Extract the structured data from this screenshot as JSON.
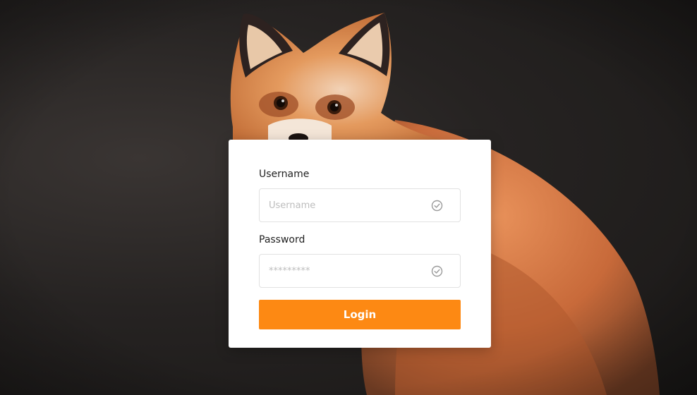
{
  "background": {
    "image": "red-fox-photo"
  },
  "form": {
    "username": {
      "label": "Username",
      "placeholder": "Username",
      "value": "",
      "icon": "check-circle-icon"
    },
    "password": {
      "label": "Password",
      "placeholder": "*********",
      "value": "",
      "icon": "check-circle-icon"
    },
    "submit_label": "Login"
  },
  "colors": {
    "accent": "#fd8913",
    "card_bg": "#ffffff",
    "input_border": "#e1e1e1"
  }
}
